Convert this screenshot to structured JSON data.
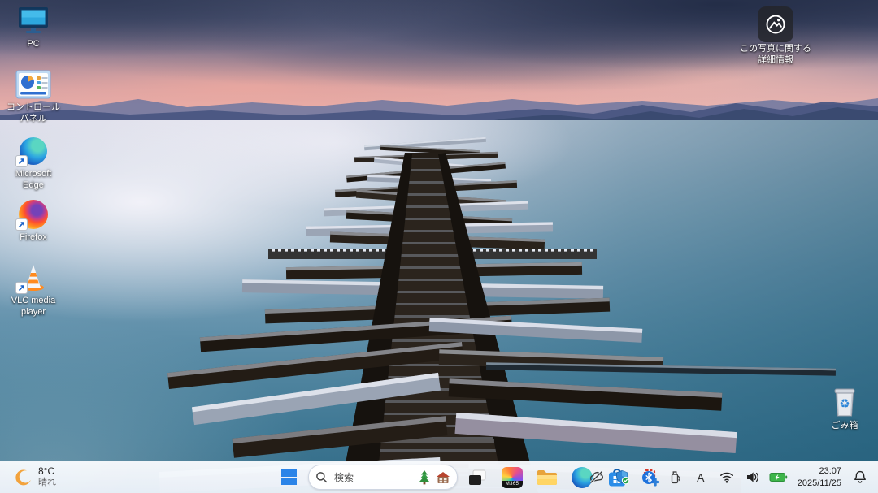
{
  "desktop": {
    "icons": [
      {
        "name": "pc",
        "label": "PC"
      },
      {
        "name": "control-panel",
        "label": "コントロール パネル"
      },
      {
        "name": "microsoft-edge",
        "label": "Microsoft Edge"
      },
      {
        "name": "firefox",
        "label": "Firefox"
      },
      {
        "name": "vlc-media-player",
        "label": "VLC media player"
      }
    ],
    "photo_info_label": "この写真に関する詳細情報",
    "recycle_bin_label": "ごみ箱"
  },
  "taskbar": {
    "weather": {
      "temperature": "8°C",
      "condition": "晴れ",
      "icon": "crescent-moon-icon"
    },
    "search_placeholder": "検索",
    "search_highlight_icons": [
      "christmas-tree-icon",
      "gingerbread-house-icon"
    ],
    "copilot_badge": "M365",
    "pinned_icons": [
      "task-view",
      "m365-copilot",
      "file-explorer",
      "microsoft-edge",
      "microsoft-store",
      "snipping-tool"
    ],
    "tray_icons": [
      "onedrive-offline",
      "windows-security",
      "bluetooth",
      "usb-device",
      "ime-mode",
      "wifi",
      "volume",
      "battery-charging",
      "notification-bell"
    ],
    "ime_mode": "A",
    "clock": {
      "time": "23:07",
      "date": "2025/11/25"
    }
  },
  "colors": {
    "taskbar_bg": "#f2f6fb",
    "accent_blue": "#2b84e8",
    "battery_green": "#3db54a",
    "security_check_green": "#21a343",
    "sunset_pink": "#e8b0ae",
    "sea_teal": "#2e6d89",
    "wood_dark": "#1b1713"
  }
}
